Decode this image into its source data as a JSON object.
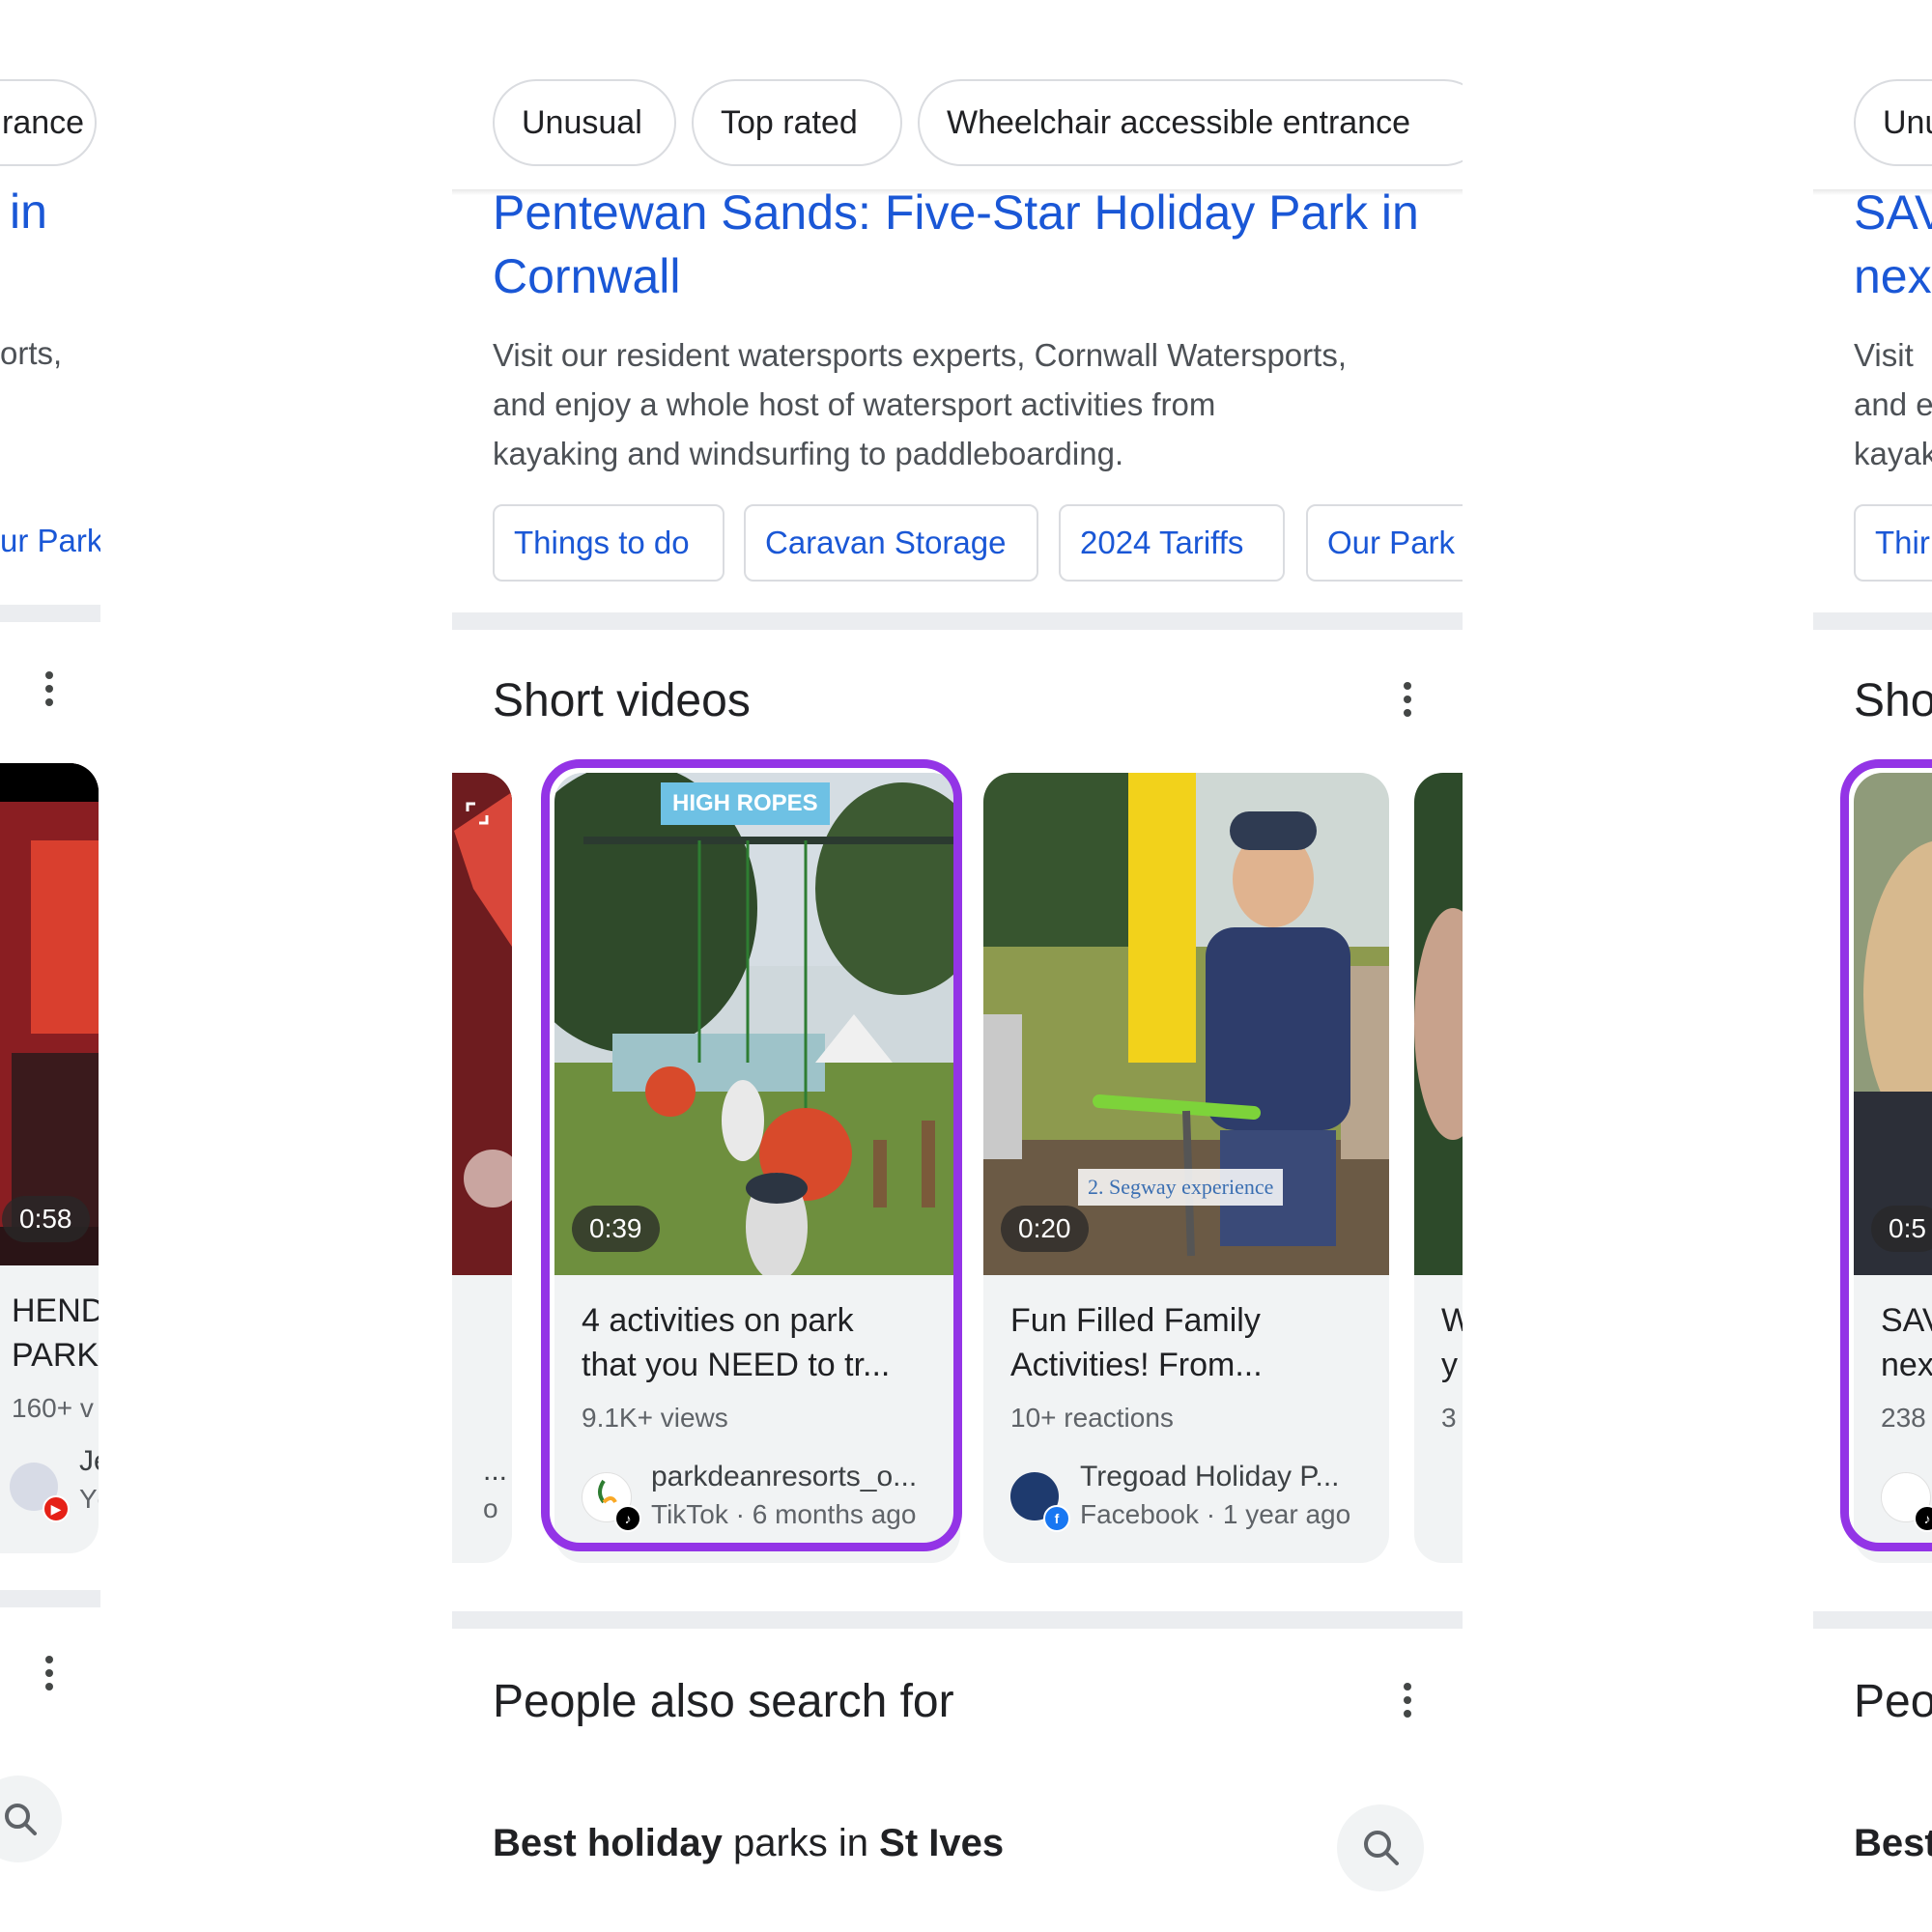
{
  "colors": {
    "link": "#1a57d6",
    "highlight": "#9334e6",
    "chip_border": "#dadce0",
    "divider": "#ebedf0"
  },
  "filters": [
    "Unusual",
    "Top rated",
    "Wheelchair accessible entrance"
  ],
  "result": {
    "title_line1": "Pentewan Sands: Five-Star Holiday Park in",
    "title_line2": "Cornwall",
    "snippet_line1": "Visit our resident watersports experts, Cornwall Watersports,",
    "snippet_line2": "and enjoy a whole host of watersport activities from",
    "snippet_line3": "kayaking and windsurfing to paddleboarding.",
    "sitelinks": [
      "Things to do",
      "Caravan Storage",
      "2024 Tariffs",
      "Our Park"
    ]
  },
  "short_videos": {
    "heading": "Short videos",
    "cards": [
      {
        "thumb_label": "HIGH ROPES",
        "duration": "0:39",
        "title_line1": "4 activities on park",
        "title_line2": "that you NEED to tr...",
        "meta": "9.1K+ views",
        "source": "parkdeanresorts_o...",
        "sub": "TikTok · 6 months ago",
        "icon": "tiktok-icon"
      },
      {
        "thumb_label": "2. Segway experience",
        "duration": "0:20",
        "title_line1": "Fun Filled Family",
        "title_line2": "Activities! From...",
        "meta": "10+ reactions",
        "source": "Tregoad Holiday P...",
        "sub": "Facebook · 1 year ago",
        "icon": "facebook-icon"
      }
    ],
    "peek_next": {
      "title_line1": "W",
      "title_line2": "y",
      "meta": "3"
    },
    "peek_prev": {
      "source_frag": "...",
      "sub_frag": "o"
    }
  },
  "people_also_search": {
    "heading": "People also search for",
    "query_bold1": "Best holiday",
    "query_normal": " parks in ",
    "query_bold2": "St Ives"
  },
  "left_panel": {
    "chip_frag": "rance",
    "title_frag": "in",
    "snippet_frag": "orts,",
    "sitelink_frag": "ur Park",
    "duration": "0:58",
    "title_line1": "HEND",
    "title_line2": "PARK",
    "meta": "160+ v",
    "source_frag": "Je",
    "sub_frag": "Yc"
  },
  "right_panel": {
    "chip_frag": "Unu",
    "title_line1": "SAV",
    "title_line2": "nex",
    "snippet_line1": "Visit",
    "snippet_line2": "and e",
    "snippet_line3": "kayak",
    "sitelink_frag": "Thir",
    "section_frag": "Sho",
    "duration": "0:5",
    "meta": "238",
    "people_frag": "Peo",
    "query_frag": "Best"
  }
}
